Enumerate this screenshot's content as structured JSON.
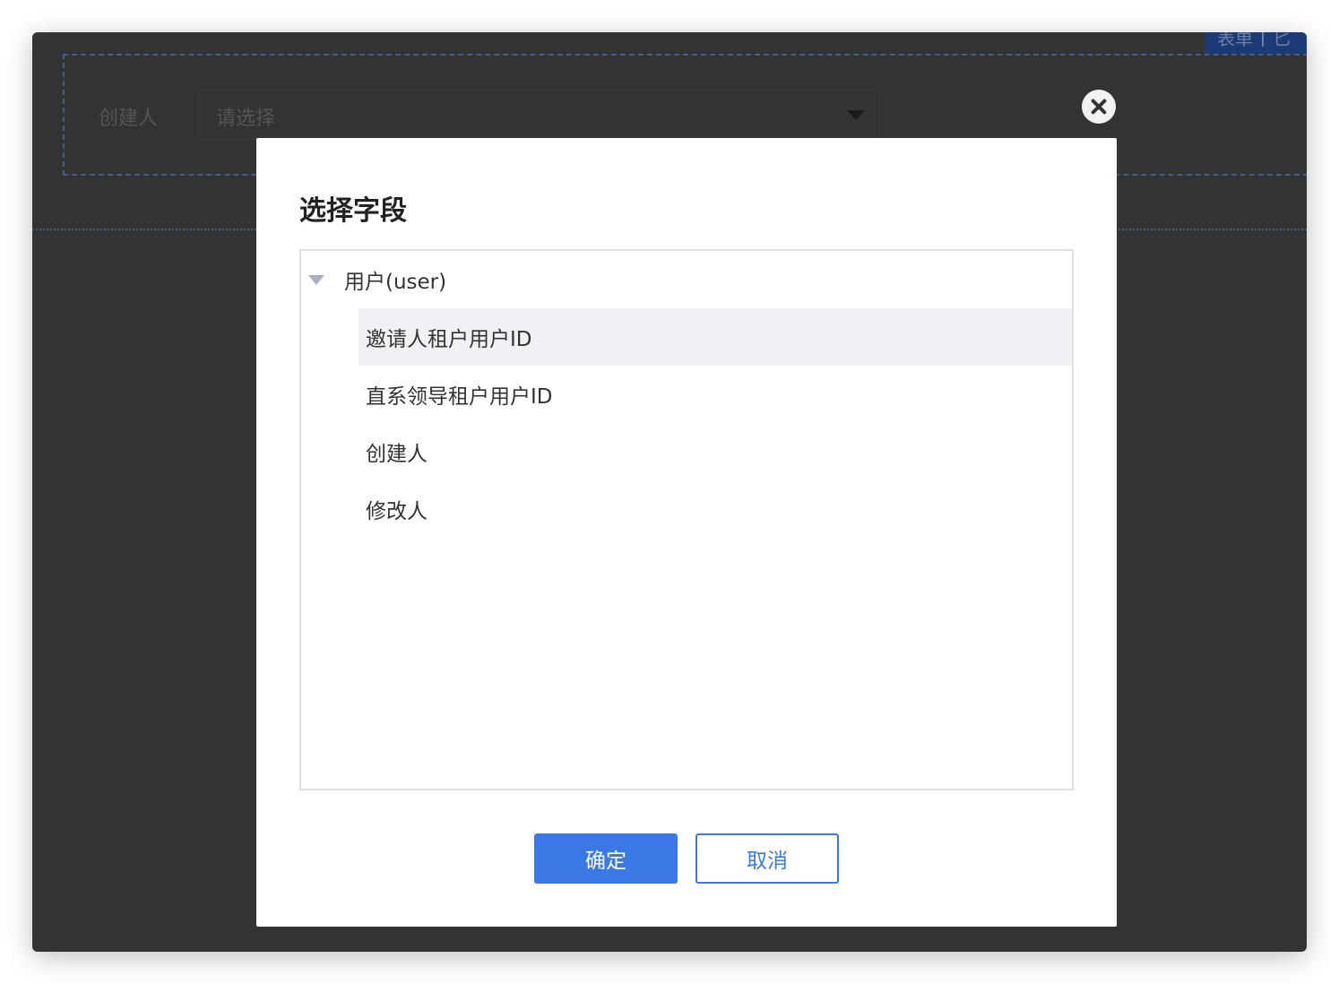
{
  "background": {
    "tabs": [
      "表单",
      "匕"
    ],
    "form": {
      "label": "创建人",
      "select_placeholder": "请选择"
    }
  },
  "modal": {
    "title": "选择字段",
    "tree": {
      "root_label": "用户(user)",
      "expanded": true,
      "children": [
        {
          "label": "邀请人租户用户ID",
          "active": true
        },
        {
          "label": "直系领导租户用户ID",
          "active": false
        },
        {
          "label": "创建人",
          "active": false
        },
        {
          "label": "修改人",
          "active": false
        }
      ]
    },
    "buttons": {
      "confirm": "确定",
      "cancel": "取消"
    }
  },
  "colors": {
    "primary": "#3a78e6",
    "overlay": "#333333",
    "active_row": "#f0f1f5"
  }
}
